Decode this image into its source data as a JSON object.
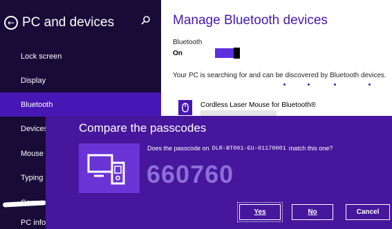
{
  "nav": {
    "title": "PC and devices",
    "back_glyph": "←",
    "search_icon": "search-icon",
    "items": [
      {
        "label": "Lock screen",
        "selected": false
      },
      {
        "label": "Display",
        "selected": false
      },
      {
        "label": "Bluetooth",
        "selected": true
      },
      {
        "label": "Devices",
        "selected": false
      },
      {
        "label": "Mouse a",
        "selected": false
      },
      {
        "label": "Typing",
        "selected": false
      },
      {
        "label": "Corners",
        "selected": false
      },
      {
        "label": "PC info",
        "selected": false
      }
    ]
  },
  "content": {
    "title": "Manage Bluetooth devices",
    "bluetooth_label": "Bluetooth",
    "bluetooth_state": "On",
    "searching_text": "Your PC is searching for and can be discovered by Bluetooth devices.",
    "device_name": "Cordless Laser Mouse for Bluetooth®"
  },
  "dialog": {
    "title": "Compare the passcodes",
    "question_prefix": "Does the passcode on",
    "device_code": "DLR-BT001-EU-01170001",
    "question_suffix": "match this one?",
    "passcode": "660760",
    "buttons": {
      "yes": "Yes",
      "no": "No",
      "cancel": "Cancel"
    }
  },
  "colors": {
    "nav_bg": "#180b38",
    "accent": "#4617b4",
    "dialog_bg": "#46169c",
    "passcode": "#8b6fd8"
  }
}
